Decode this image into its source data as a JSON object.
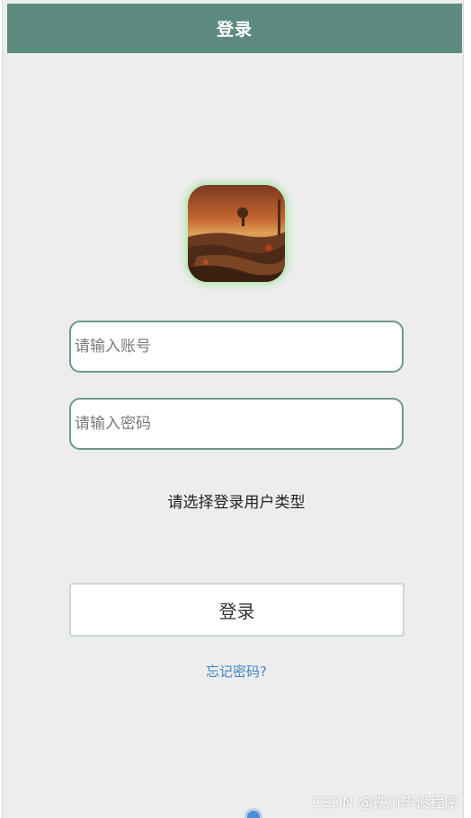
{
  "header": {
    "title": "登录"
  },
  "avatar": {
    "icon": "landscape-avatar-image"
  },
  "form": {
    "account_placeholder": "请输入账号",
    "password_placeholder": "请输入密码",
    "user_type_label": "请选择登录用户类型",
    "login_label": "登录",
    "forgot_label": "忘记密码?"
  },
  "watermark": "CSDN @铁川毕设程序",
  "colors": {
    "header_bg": "#5c8b80",
    "field_border": "#6f978d",
    "link": "#3f83c9",
    "avatar_glow": "#98e698"
  }
}
